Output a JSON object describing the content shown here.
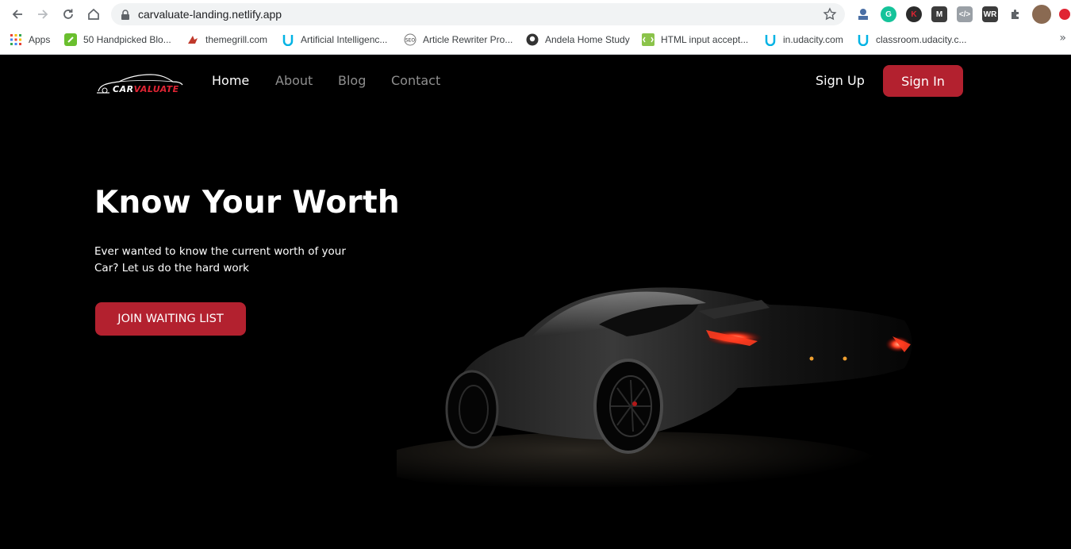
{
  "browser": {
    "url": "carvaluate-landing.netlify.app",
    "bookmarks": [
      {
        "label": "Apps",
        "icon": "apps-grid-icon"
      },
      {
        "label": "50 Handpicked Blo...",
        "icon": "link-icon"
      },
      {
        "label": "themegrill.com",
        "icon": "themegrill-icon"
      },
      {
        "label": "Artificial Intelligenc...",
        "icon": "udacity-icon"
      },
      {
        "label": "Article Rewriter Pro...",
        "icon": "seo-icon"
      },
      {
        "label": "Andela Home Study",
        "icon": "github-icon"
      },
      {
        "label": "HTML input accept...",
        "icon": "html-icon"
      },
      {
        "label": "in.udacity.com",
        "icon": "udacity-icon"
      },
      {
        "label": "classroom.udacity.c...",
        "icon": "udacity-icon"
      }
    ],
    "more_label": "»"
  },
  "brand": {
    "logo_part1": "CAR",
    "logo_part2": "VALUATE",
    "primary_color": "#b3212f",
    "accent_red": "#e02433"
  },
  "nav": {
    "links": [
      "Home",
      "About",
      "Blog",
      "Contact"
    ],
    "active": "Home",
    "signup_label": "Sign Up",
    "signin_label": "Sign In"
  },
  "hero": {
    "title": "Know Your Worth",
    "subtitle": "Ever wanted to know the current worth of your Car? Let us do the hard work",
    "cta_label": "JOIN WAITING LIST"
  }
}
